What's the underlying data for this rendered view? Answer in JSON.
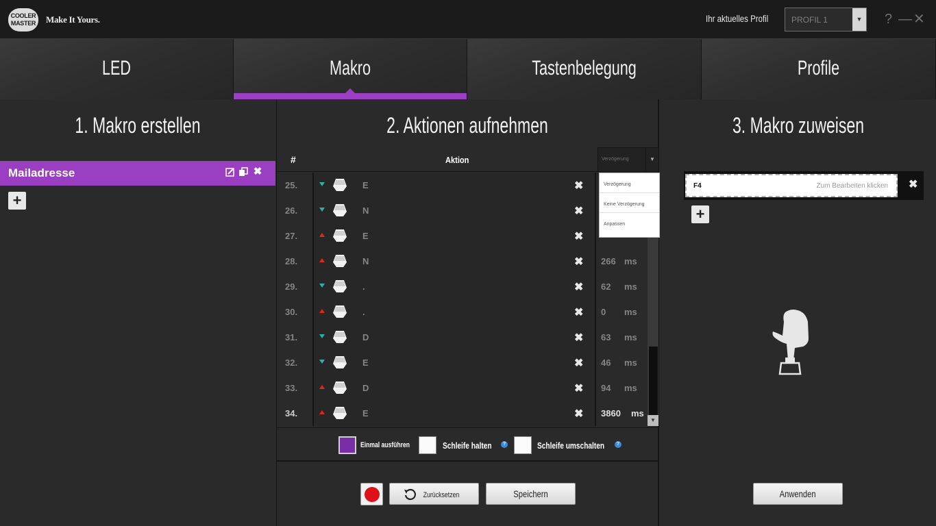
{
  "header": {
    "logo": "COOLER MASTER",
    "tagline": "Make It Yours.",
    "profile_label": "Ihr aktuelles Profil",
    "profile_value": "PROFIL 1",
    "help": "?",
    "minimize": "—",
    "close": "✕"
  },
  "tabs": [
    {
      "label": "LED",
      "active": false
    },
    {
      "label": "Makro",
      "active": true
    },
    {
      "label": "Tastenbelegung",
      "active": false
    },
    {
      "label": "Profile",
      "active": false
    }
  ],
  "left": {
    "title": "1. Makro erstellen",
    "macro_name": "Mailadresse",
    "add_label": "+"
  },
  "middle": {
    "title": "2. Aktionen aufnehmen",
    "col_num": "#",
    "col_action": "Aktion",
    "delay_select": "Verzögerung",
    "delay_options": [
      "Verzögerung",
      "Keine Verzögerung",
      "Anpassen"
    ],
    "rows": [
      {
        "num": "25.",
        "dir": "down",
        "key": "E",
        "delay": "",
        "unit": ""
      },
      {
        "num": "26.",
        "dir": "down",
        "key": "N",
        "delay": "",
        "unit": ""
      },
      {
        "num": "27.",
        "dir": "up",
        "key": "E",
        "delay": "",
        "unit": ""
      },
      {
        "num": "28.",
        "dir": "up",
        "key": "N",
        "delay": "266",
        "unit": "ms"
      },
      {
        "num": "29.",
        "dir": "down",
        "key": ".",
        "delay": "62",
        "unit": "ms"
      },
      {
        "num": "30.",
        "dir": "up",
        "key": ".",
        "delay": "0",
        "unit": "ms"
      },
      {
        "num": "31.",
        "dir": "down",
        "key": "D",
        "delay": "63",
        "unit": "ms"
      },
      {
        "num": "32.",
        "dir": "down",
        "key": "E",
        "delay": "46",
        "unit": "ms"
      },
      {
        "num": "33.",
        "dir": "up",
        "key": "D",
        "delay": "94",
        "unit": "ms"
      },
      {
        "num": "34.",
        "dir": "up",
        "key": "E",
        "delay": "3860",
        "unit": "ms"
      }
    ],
    "options": {
      "once": "Einmal ausführen",
      "loop_hold": "Schleife halten",
      "loop_toggle": "Schleife umschalten",
      "help": "?"
    },
    "buttons": {
      "reset": "Zurücksetzen",
      "save": "Speichern"
    }
  },
  "right": {
    "title": "3. Makro zuweisen",
    "assigned_key": "F4",
    "edit_hint": "Zum Bearbeiten klicken",
    "apply": "Anwenden",
    "add_label": "+"
  },
  "colors": {
    "accent": "#9a3fc2",
    "key_down": "#2ab2a3",
    "key_up": "#e0261d",
    "record": "#e0101a"
  }
}
